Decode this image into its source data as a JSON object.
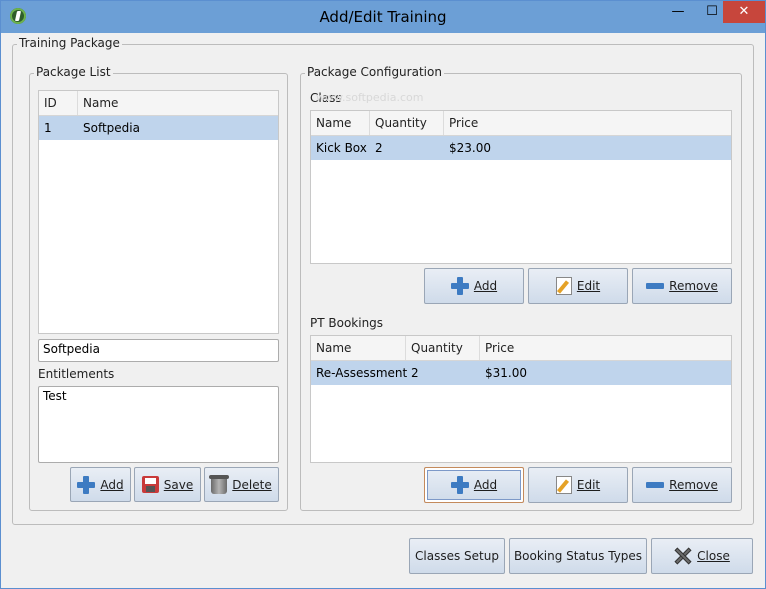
{
  "window": {
    "title": "Add/Edit Training",
    "min": "—",
    "max": "☐",
    "close": "✕"
  },
  "training_package": {
    "legend": "Training Package"
  },
  "package_list": {
    "legend": "Package List",
    "columns": [
      "ID",
      "Name"
    ],
    "rows": [
      {
        "id": "1",
        "name": "Softpedia"
      }
    ],
    "name_value": "Softpedia",
    "entitlements_label": "Entitlements",
    "entitlements_value": "Test",
    "buttons": {
      "add": "Add",
      "save": "Save",
      "delete": "Delete"
    }
  },
  "package_config": {
    "legend": "Package Configuration",
    "watermark": "www.softpedia.com",
    "class": {
      "label": "Class",
      "columns": [
        "Name",
        "Quantity",
        "Price"
      ],
      "rows": [
        {
          "name": "Kick Box",
          "quantity": "2",
          "price": "$23.00"
        }
      ],
      "buttons": {
        "add": "Add",
        "edit": "Edit",
        "remove": "Remove"
      }
    },
    "pt": {
      "label": "PT Bookings",
      "columns": [
        "Name",
        "Quantity",
        "Price"
      ],
      "rows": [
        {
          "name": "Re-Assessment",
          "quantity": "2",
          "price": "$31.00"
        }
      ],
      "buttons": {
        "add": "Add",
        "edit": "Edit",
        "remove": "Remove"
      }
    }
  },
  "footer": {
    "classes_setup": "Classes Setup",
    "booking_status_types": "Booking Status Types",
    "close": "Close"
  }
}
